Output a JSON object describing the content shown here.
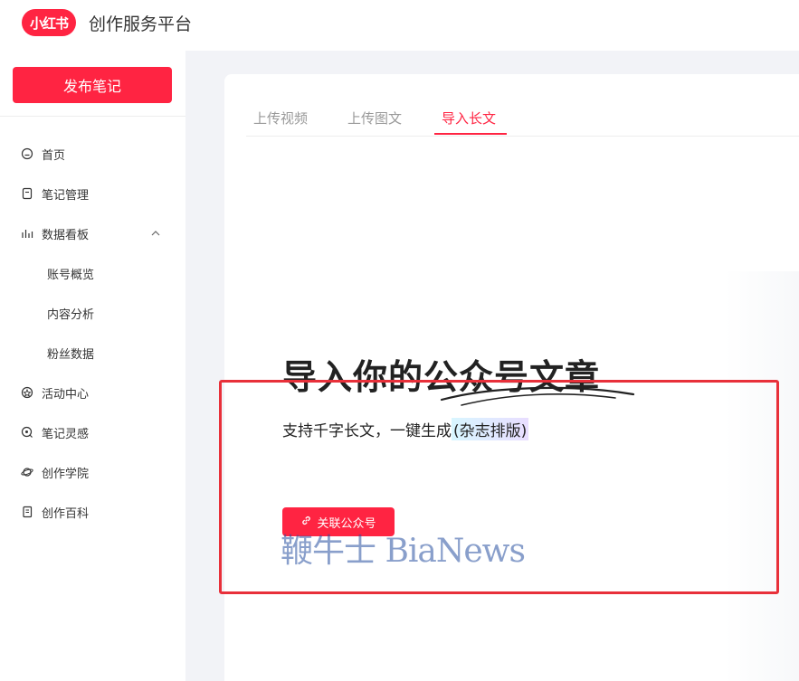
{
  "header": {
    "logo_text": "小红书",
    "platform_title": "创作服务平台"
  },
  "sidebar": {
    "publish_label": "发布笔记",
    "items": [
      {
        "label": "首页",
        "icon": "home-icon"
      },
      {
        "label": "笔记管理",
        "icon": "note-icon"
      },
      {
        "label": "数据看板",
        "icon": "bar-chart-icon",
        "expanded": true
      },
      {
        "label": "账号概览",
        "sub": true
      },
      {
        "label": "内容分析",
        "sub": true
      },
      {
        "label": "粉丝数据",
        "sub": true
      },
      {
        "label": "活动中心",
        "icon": "activity-icon"
      },
      {
        "label": "笔记灵感",
        "icon": "inspiration-icon"
      },
      {
        "label": "创作学院",
        "icon": "planet-icon"
      },
      {
        "label": "创作百科",
        "icon": "book-icon"
      }
    ]
  },
  "main": {
    "tabs": [
      {
        "label": "上传视频",
        "active": false
      },
      {
        "label": "上传图文",
        "active": false
      },
      {
        "label": "导入长文",
        "active": true
      }
    ],
    "hero_title": "导入你的公众号文章",
    "hero_subtitle_prefix": "支持千字长文，一键生成",
    "hero_subtitle_highlight": "(杂志排版)",
    "link_button_label": "关联公众号"
  },
  "watermark": "鞭牛士 BiaNews",
  "colors": {
    "brand": "#ff2442",
    "highlight_box": "#e8303a"
  }
}
